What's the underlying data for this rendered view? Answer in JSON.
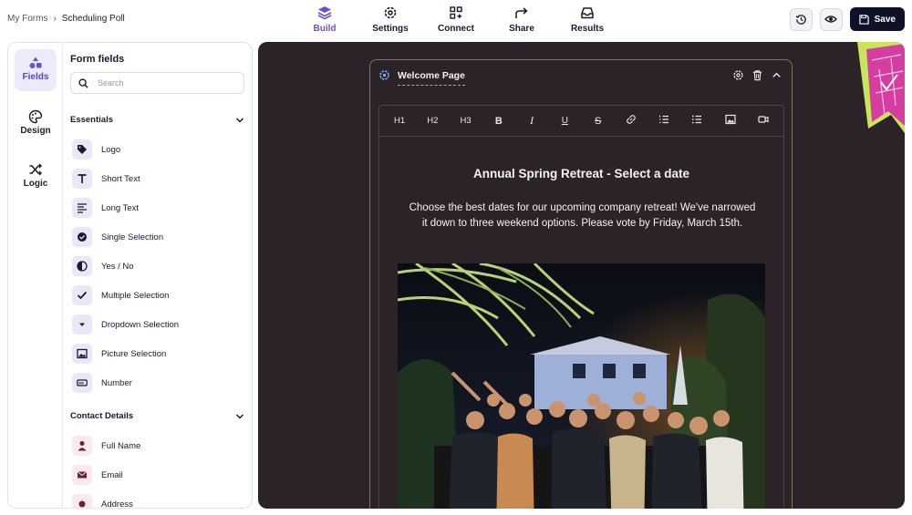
{
  "breadcrumb": {
    "parent": "My Forms",
    "separator": "›",
    "current": "Scheduling Poll"
  },
  "nav": {
    "tabs": [
      {
        "label": "Build",
        "icon": "layers-icon",
        "active": true
      },
      {
        "label": "Settings",
        "icon": "gear-icon",
        "active": false
      },
      {
        "label": "Connect",
        "icon": "connect-grid-icon",
        "active": false
      },
      {
        "label": "Share",
        "icon": "share-arrow-icon",
        "active": false
      },
      {
        "label": "Results",
        "icon": "inbox-icon",
        "active": false
      }
    ]
  },
  "actions": {
    "history_icon": "history-icon",
    "preview_icon": "eye-icon",
    "save_label": "Save"
  },
  "rail": {
    "items": [
      {
        "label": "Fields",
        "icon": "shapes-icon",
        "active": true
      },
      {
        "label": "Design",
        "icon": "palette-icon",
        "active": false
      },
      {
        "label": "Logic",
        "icon": "shuffle-icon",
        "active": false
      }
    ]
  },
  "fields_panel": {
    "title": "Form fields",
    "search_placeholder": "Search",
    "sections": [
      {
        "title": "Essentials",
        "items": [
          "Logo",
          "Short Text",
          "Long Text",
          "Single Selection",
          "Yes / No",
          "Multiple Selection",
          "Dropdown Selection",
          "Picture Selection",
          "Number"
        ]
      },
      {
        "title": "Contact Details",
        "items": [
          "Full Name",
          "Email",
          "Address"
        ]
      }
    ]
  },
  "card": {
    "title": "Welcome Page",
    "toolbar": [
      "H1",
      "H2",
      "H3",
      "B",
      "I",
      "U",
      "S"
    ],
    "heading": "Annual Spring Retreat - Select a date",
    "body": "Choose the best dates for our upcoming company retreat! We've narrowed it down to three weekend options. Please vote by Friday, March 15th."
  },
  "colors": {
    "accent": "#6a4fd1",
    "canvas": "#2b2327",
    "save_bg": "#0f1226",
    "deco_pink": "#d63da0",
    "deco_lime": "#c9e65a"
  }
}
